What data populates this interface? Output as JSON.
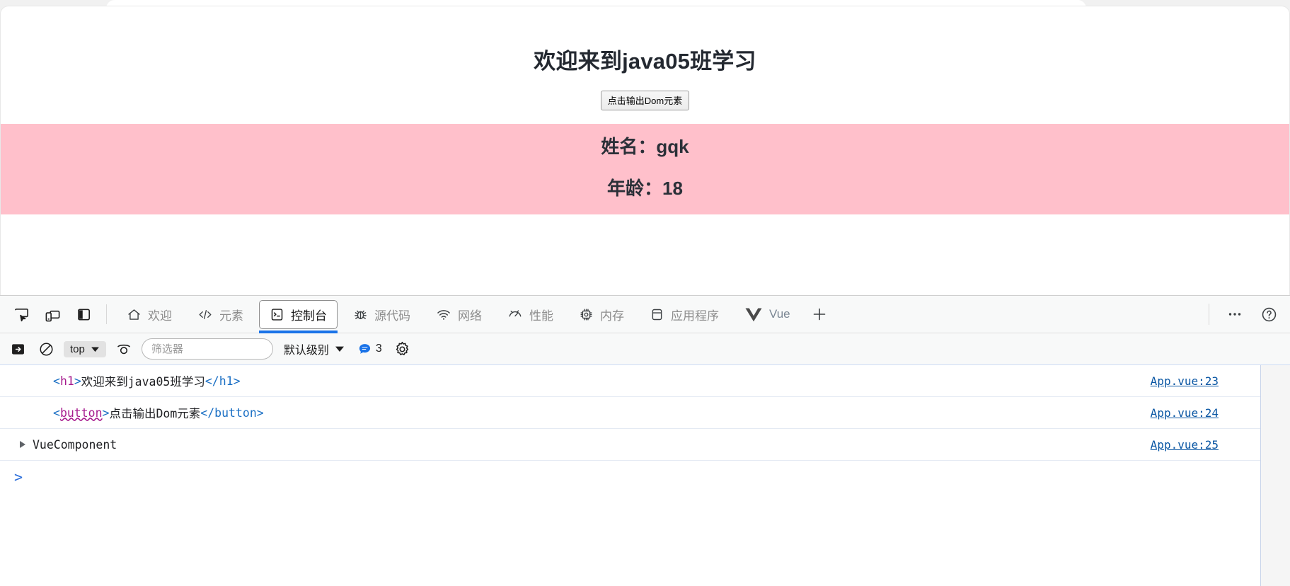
{
  "page": {
    "title": "欢迎来到java05班学习",
    "button_label": "点击输出Dom元素",
    "panel_bg": "#ffc0cb",
    "info_lines": [
      "姓名：gqk",
      "年龄：18"
    ]
  },
  "devtools": {
    "left_tools": [
      {
        "name": "inspect-element-icon",
        "label": "检查元素"
      },
      {
        "name": "device-toolbar-icon",
        "label": "设备工具栏"
      },
      {
        "name": "dock-side-icon",
        "label": "停靠位置"
      }
    ],
    "tabs": [
      {
        "label": "欢迎",
        "icon": "home-icon",
        "selected": false
      },
      {
        "label": "元素",
        "icon": "code-icon",
        "selected": false
      },
      {
        "label": "控制台",
        "icon": "console-icon",
        "selected": true
      },
      {
        "label": "源代码",
        "icon": "bug-icon",
        "selected": false
      },
      {
        "label": "网络",
        "icon": "wifi-icon",
        "selected": false
      },
      {
        "label": "性能",
        "icon": "performance-icon",
        "selected": false
      },
      {
        "label": "内存",
        "icon": "memory-chip-icon",
        "selected": false
      },
      {
        "label": "应用程序",
        "icon": "database-icon",
        "selected": false
      },
      {
        "label": "Vue",
        "icon": "vue-logo-icon",
        "selected": false
      }
    ],
    "add_tab_label": "+",
    "more_label": "⋯",
    "help_label": "?",
    "selected_tab_accent": "#1a73e8",
    "filterbar": {
      "sidebar_toggle": "console-sidebar-icon",
      "clear_label": "clear-console-icon",
      "context": "top",
      "eye_icon": "live-expression-icon",
      "filter_placeholder": "筛选器",
      "filter_value": "",
      "level": "默认级别",
      "message_count": "3",
      "settings_icon": "gear-icon"
    },
    "logs": [
      {
        "kind": "html",
        "expandable": false,
        "open_punc_l": "<",
        "tag": "h1",
        "tag_error": false,
        "open_punc_r": ">",
        "text": "欢迎来到java05班学习",
        "close": "</h1>",
        "source": "App.vue:23"
      },
      {
        "kind": "html",
        "expandable": false,
        "open_punc_l": "<",
        "tag": "button",
        "tag_error": true,
        "open_punc_r": ">",
        "text": "点击输出Dom元素",
        "close": "</button>",
        "source": "App.vue:24"
      },
      {
        "kind": "object",
        "expandable": true,
        "text": "VueComponent",
        "source": "App.vue:25"
      }
    ],
    "prompt": ">"
  }
}
